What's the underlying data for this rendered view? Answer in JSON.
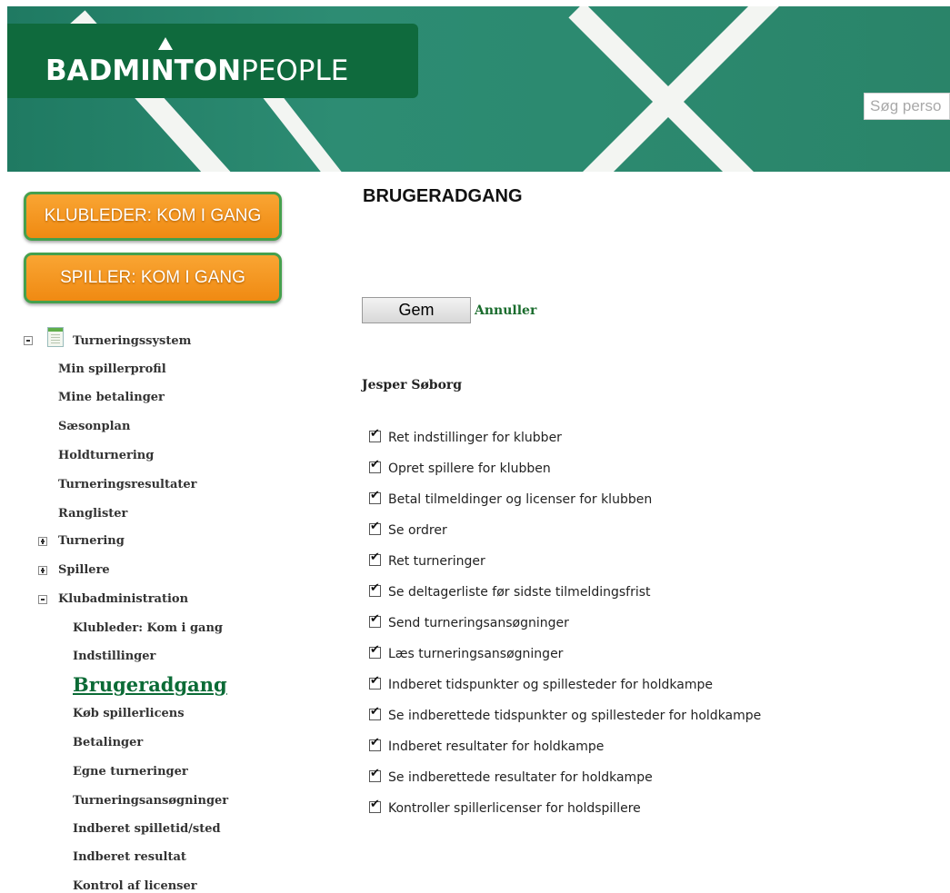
{
  "header": {
    "logo_bold": "BADMINTON",
    "logo_light": "PEOPLE",
    "search_placeholder": "Søg perso"
  },
  "sidebar": {
    "buttons": [
      {
        "label": "KLUBLEDER: KOM I GANG"
      },
      {
        "label": "SPILLER: KOM I GANG"
      }
    ],
    "tree_root": "Turneringssystem",
    "items": [
      {
        "label": "Min spillerprofil"
      },
      {
        "label": "Mine betalinger"
      },
      {
        "label": "Sæsonplan"
      },
      {
        "label": "Holdturnering"
      },
      {
        "label": "Turneringsresultater"
      },
      {
        "label": "Ranglister"
      },
      {
        "label": "Turnering"
      },
      {
        "label": "Spillere"
      },
      {
        "label": "Klubadministration"
      }
    ],
    "sub_items": [
      {
        "label": "Klubleder: Kom i gang"
      },
      {
        "label": "Indstillinger"
      },
      {
        "label": "Brugeradgang"
      },
      {
        "label": "Køb spillerlicens"
      },
      {
        "label": "Betalinger"
      },
      {
        "label": "Egne turneringer"
      },
      {
        "label": "Turneringsansøgninger"
      },
      {
        "label": "Indberet spilletid/sted"
      },
      {
        "label": "Indberet resultat"
      },
      {
        "label": "Kontrol af licenser"
      }
    ]
  },
  "main": {
    "title": "BRUGERADGANG",
    "save_label": "Gem",
    "cancel_label": "Annuller",
    "user_name": "Jesper Søborg",
    "permissions": [
      {
        "label": "Ret indstillinger for klubber",
        "checked": true
      },
      {
        "label": "Opret spillere for klubben",
        "checked": true
      },
      {
        "label": "Betal tilmeldinger og licenser for klubben",
        "checked": true
      },
      {
        "label": "Se ordrer",
        "checked": true
      },
      {
        "label": "Ret turneringer",
        "checked": true
      },
      {
        "label": "Se deltagerliste før sidste tilmeldingsfrist",
        "checked": true
      },
      {
        "label": "Send turneringsansøgninger",
        "checked": true
      },
      {
        "label": "Læs turneringsansøgninger",
        "checked": true
      },
      {
        "label": "Indberet tidspunkter og spillesteder for holdkampe",
        "checked": true
      },
      {
        "label": "Se indberettede tidspunkter og spillesteder for holdkampe",
        "checked": true
      },
      {
        "label": "Indberet resultater for holdkampe",
        "checked": true
      },
      {
        "label": "Se indberettede resultater for holdkampe",
        "checked": true
      },
      {
        "label": "Kontroller spillerlicenser for holdspillere",
        "checked": true
      }
    ]
  }
}
